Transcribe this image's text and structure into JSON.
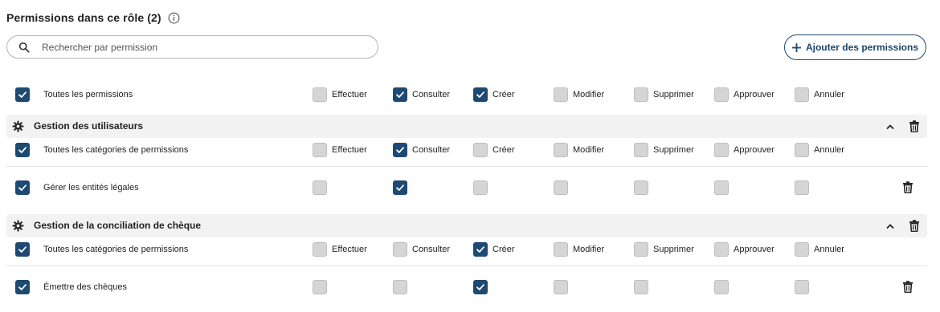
{
  "header": {
    "title": "Permissions dans ce rôle (2)"
  },
  "search": {
    "placeholder": "Rechercher par permission"
  },
  "actions": {
    "add_label": "Ajouter des permissions"
  },
  "columns": [
    "Effectuer",
    "Consulter",
    "Créer",
    "Modifier",
    "Supprimer",
    "Approuver",
    "Annuler"
  ],
  "all_row": {
    "label": "Toutes les permissions",
    "checked": true,
    "values": [
      false,
      true,
      true,
      false,
      false,
      false,
      false
    ]
  },
  "groups": [
    {
      "name": "Gestion des utilisateurs",
      "category_row": {
        "label": "Toutes les catégories de permissions",
        "checked": true,
        "values": [
          false,
          true,
          false,
          false,
          false,
          false,
          false
        ]
      },
      "items": [
        {
          "label": "Gérer les entités légales",
          "checked": true,
          "values": [
            false,
            true,
            false,
            false,
            false,
            false,
            false
          ]
        }
      ]
    },
    {
      "name": "Gestion de la conciliation de chèque",
      "category_row": {
        "label": "Toutes les catégories de permissions",
        "checked": true,
        "values": [
          false,
          false,
          true,
          false,
          false,
          false,
          false
        ]
      },
      "items": [
        {
          "label": "Émettre des chèques",
          "checked": true,
          "values": [
            false,
            false,
            true,
            false,
            false,
            false,
            false
          ]
        }
      ]
    }
  ],
  "colors": {
    "primary": "#1d4972",
    "checkbox_off": "#d5d5d5",
    "group_bg": "#f2f2f3"
  },
  "icons": [
    "info-icon",
    "search-icon",
    "plus-icon",
    "gear-icon",
    "chevron-up-icon",
    "trash-icon",
    "check-icon"
  ]
}
